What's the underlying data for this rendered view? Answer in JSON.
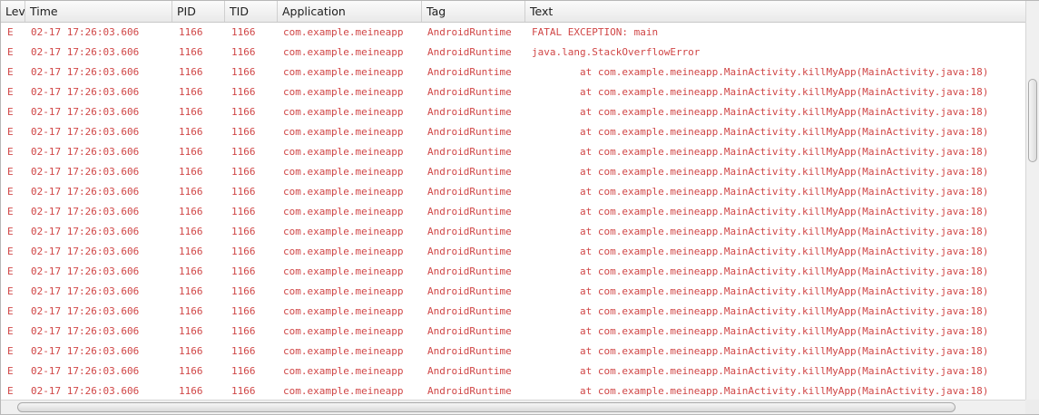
{
  "columns": {
    "level": "Lev",
    "time": "Time",
    "pid": "PID",
    "tid": "TID",
    "application": "Application",
    "tag": "Tag",
    "text": "Text"
  },
  "colors": {
    "error_text": "#d04646",
    "header_text": "#1e1e1e"
  },
  "rows": [
    {
      "level": "E",
      "time": "02-17 17:26:03.606",
      "pid": "1166",
      "tid": "1166",
      "application": "com.example.meineapp",
      "tag": "AndroidRuntime",
      "text": "FATAL EXCEPTION: main"
    },
    {
      "level": "E",
      "time": "02-17 17:26:03.606",
      "pid": "1166",
      "tid": "1166",
      "application": "com.example.meineapp",
      "tag": "AndroidRuntime",
      "text": "java.lang.StackOverflowError"
    },
    {
      "level": "E",
      "time": "02-17 17:26:03.606",
      "pid": "1166",
      "tid": "1166",
      "application": "com.example.meineapp",
      "tag": "AndroidRuntime",
      "text": "        at com.example.meineapp.MainActivity.killMyApp(MainActivity.java:18)"
    },
    {
      "level": "E",
      "time": "02-17 17:26:03.606",
      "pid": "1166",
      "tid": "1166",
      "application": "com.example.meineapp",
      "tag": "AndroidRuntime",
      "text": "        at com.example.meineapp.MainActivity.killMyApp(MainActivity.java:18)"
    },
    {
      "level": "E",
      "time": "02-17 17:26:03.606",
      "pid": "1166",
      "tid": "1166",
      "application": "com.example.meineapp",
      "tag": "AndroidRuntime",
      "text": "        at com.example.meineapp.MainActivity.killMyApp(MainActivity.java:18)"
    },
    {
      "level": "E",
      "time": "02-17 17:26:03.606",
      "pid": "1166",
      "tid": "1166",
      "application": "com.example.meineapp",
      "tag": "AndroidRuntime",
      "text": "        at com.example.meineapp.MainActivity.killMyApp(MainActivity.java:18)"
    },
    {
      "level": "E",
      "time": "02-17 17:26:03.606",
      "pid": "1166",
      "tid": "1166",
      "application": "com.example.meineapp",
      "tag": "AndroidRuntime",
      "text": "        at com.example.meineapp.MainActivity.killMyApp(MainActivity.java:18)"
    },
    {
      "level": "E",
      "time": "02-17 17:26:03.606",
      "pid": "1166",
      "tid": "1166",
      "application": "com.example.meineapp",
      "tag": "AndroidRuntime",
      "text": "        at com.example.meineapp.MainActivity.killMyApp(MainActivity.java:18)"
    },
    {
      "level": "E",
      "time": "02-17 17:26:03.606",
      "pid": "1166",
      "tid": "1166",
      "application": "com.example.meineapp",
      "tag": "AndroidRuntime",
      "text": "        at com.example.meineapp.MainActivity.killMyApp(MainActivity.java:18)"
    },
    {
      "level": "E",
      "time": "02-17 17:26:03.606",
      "pid": "1166",
      "tid": "1166",
      "application": "com.example.meineapp",
      "tag": "AndroidRuntime",
      "text": "        at com.example.meineapp.MainActivity.killMyApp(MainActivity.java:18)"
    },
    {
      "level": "E",
      "time": "02-17 17:26:03.606",
      "pid": "1166",
      "tid": "1166",
      "application": "com.example.meineapp",
      "tag": "AndroidRuntime",
      "text": "        at com.example.meineapp.MainActivity.killMyApp(MainActivity.java:18)"
    },
    {
      "level": "E",
      "time": "02-17 17:26:03.606",
      "pid": "1166",
      "tid": "1166",
      "application": "com.example.meineapp",
      "tag": "AndroidRuntime",
      "text": "        at com.example.meineapp.MainActivity.killMyApp(MainActivity.java:18)"
    },
    {
      "level": "E",
      "time": "02-17 17:26:03.606",
      "pid": "1166",
      "tid": "1166",
      "application": "com.example.meineapp",
      "tag": "AndroidRuntime",
      "text": "        at com.example.meineapp.MainActivity.killMyApp(MainActivity.java:18)"
    },
    {
      "level": "E",
      "time": "02-17 17:26:03.606",
      "pid": "1166",
      "tid": "1166",
      "application": "com.example.meineapp",
      "tag": "AndroidRuntime",
      "text": "        at com.example.meineapp.MainActivity.killMyApp(MainActivity.java:18)"
    },
    {
      "level": "E",
      "time": "02-17 17:26:03.606",
      "pid": "1166",
      "tid": "1166",
      "application": "com.example.meineapp",
      "tag": "AndroidRuntime",
      "text": "        at com.example.meineapp.MainActivity.killMyApp(MainActivity.java:18)"
    },
    {
      "level": "E",
      "time": "02-17 17:26:03.606",
      "pid": "1166",
      "tid": "1166",
      "application": "com.example.meineapp",
      "tag": "AndroidRuntime",
      "text": "        at com.example.meineapp.MainActivity.killMyApp(MainActivity.java:18)"
    },
    {
      "level": "E",
      "time": "02-17 17:26:03.606",
      "pid": "1166",
      "tid": "1166",
      "application": "com.example.meineapp",
      "tag": "AndroidRuntime",
      "text": "        at com.example.meineapp.MainActivity.killMyApp(MainActivity.java:18)"
    },
    {
      "level": "E",
      "time": "02-17 17:26:03.606",
      "pid": "1166",
      "tid": "1166",
      "application": "com.example.meineapp",
      "tag": "AndroidRuntime",
      "text": "        at com.example.meineapp.MainActivity.killMyApp(MainActivity.java:18)"
    },
    {
      "level": "E",
      "time": "02-17 17:26:03.606",
      "pid": "1166",
      "tid": "1166",
      "application": "com.example.meineapp",
      "tag": "AndroidRuntime",
      "text": "        at com.example.meineapp.MainActivity.killMyApp(MainActivity.java:18)"
    }
  ]
}
